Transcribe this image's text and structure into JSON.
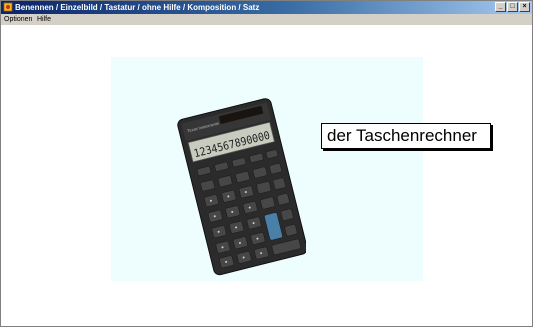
{
  "window": {
    "title": "Benennen / Einzelbild / Tastatur / ohne Hilfe / Komposition / Satz",
    "controls": {
      "minimize": "_",
      "maximize": "□",
      "close": "×"
    }
  },
  "menu": {
    "items": [
      {
        "label": "Optionen"
      },
      {
        "label": "Hilfe"
      }
    ]
  },
  "main": {
    "caption": "der Taschenrechner",
    "calculator": {
      "display": "1234567890000",
      "brand": "Texas Instruments"
    }
  },
  "colors": {
    "title_gradient_start": "#0a246a",
    "title_gradient_end": "#a6caf0",
    "image_background": "#eefdfe"
  }
}
